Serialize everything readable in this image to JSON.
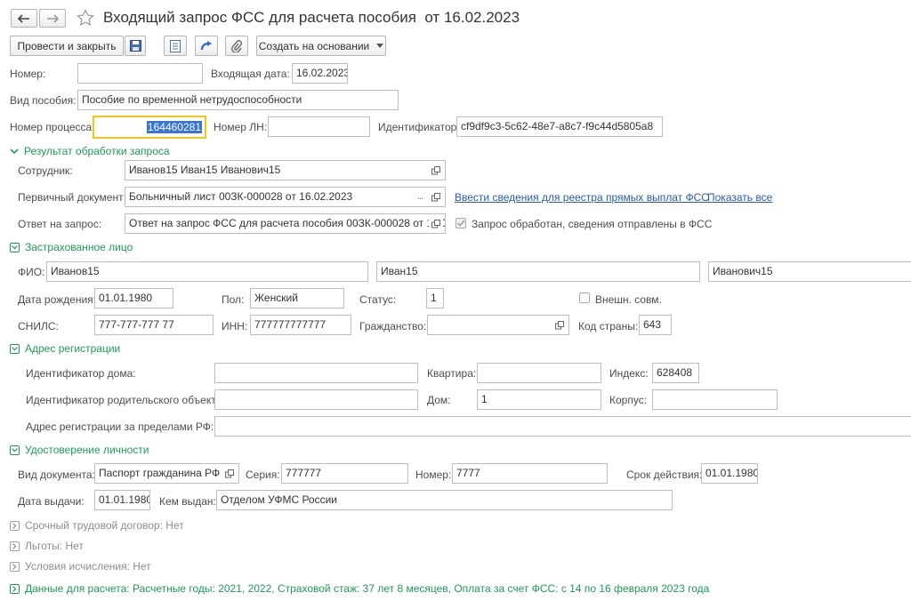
{
  "window": {
    "title": "Входящий запрос ФСС для расчета пособия  от 16.02.2023"
  },
  "toolbar": {
    "post_close": "Провести и закрыть",
    "create_based": "Создать на основании"
  },
  "header": {
    "number_label": "Номер:",
    "number_value": "",
    "in_date_label": "Входящая дата:",
    "in_date_value": "16.02.2023",
    "benefit_label": "Вид пособия:",
    "benefit_value": "Пособие по временной нетрудоспособности",
    "process_label": "Номер процесса:",
    "process_value": "164460281",
    "ln_label": "Номер ЛН:",
    "ln_value": "",
    "ident_label": "Идентификатор:",
    "ident_value": "cf9df9c3-5c62-48e7-a8c7-f9c44d5805a8"
  },
  "result": {
    "title": "Результат обработки запроса",
    "employee_label": "Сотрудник:",
    "employee_value": "Иванов15 Иван15 Иванович15",
    "primary_label": "Первичный документ:",
    "primary_value": "Больничный лист 00ЗК-000028 от 16.02.2023",
    "enter_link": "Ввести сведения для реестра прямых выплат ФСС",
    "show_all_link": "Показать все",
    "answer_label": "Ответ на запрос:",
    "answer_value": "Ответ на запрос ФСС для расчета пособия 00ЗК-000028 от 16.02.2023",
    "processed_label": "Запрос обработан, сведения отправлены в ФСС"
  },
  "insured": {
    "title": "Застрахованное лицо",
    "fio_label": "ФИО:",
    "last_name": "Иванов15",
    "first_name": "Иван15",
    "middle_name": "Иванович15",
    "birth_label": "Дата рождения:",
    "birth_value": "01.01.1980",
    "sex_label": "Пол:",
    "sex_value": "Женский",
    "status_label": "Статус:",
    "status_value": "1",
    "ext_label": "Внешн. совм.",
    "snils_label": "СНИЛС:",
    "snils_value": "777-777-777 77",
    "inn_label": "ИНН:",
    "inn_value": "777777777777",
    "citizen_label": "Гражданство:",
    "citizen_value": "",
    "country_label": "Код страны:",
    "country_value": "643"
  },
  "address": {
    "title": "Адрес регистрации",
    "house_id_label": "Идентификатор дома:",
    "house_id_value": "",
    "flat_label": "Квартира:",
    "flat_value": "",
    "index_label": "Индекс:",
    "index_value": "628408",
    "parent_id_label": "Идентификатор родительского объекта:",
    "parent_id_value": "",
    "house_label": "Дом:",
    "house_value": "1",
    "korpus_label": "Корпус:",
    "korpus_value": "",
    "abroad_label": "Адрес регистрации за пределами РФ:",
    "abroad_value": ""
  },
  "identity": {
    "title": "Удостоверение личности",
    "doc_type_label": "Вид документа:",
    "doc_type_value": "Паспорт гражданина РФ",
    "series_label": "Серия:",
    "series_value": "777777",
    "number_label": "Номер:",
    "number_value": "7777",
    "valid_label": "Срок действия:",
    "valid_value": "01.01.1980",
    "issue_date_label": "Дата выдачи:",
    "issue_date_value": "01.01.1980",
    "issued_by_label": "Кем выдан:",
    "issued_by_value": "Отделом УФМС России"
  },
  "collapsed": {
    "contract": "Срочный трудовой договор: Нет",
    "benefits": "Льготы: Нет",
    "conditions": "Условия исчисления: Нет",
    "calc_data": "Данные для расчета: Расчетные годы: 2021, 2022, Страховой стаж: 37 лет 8 месяцев, Оплата за счет ФСС: с 14 по 16 февраля 2023 года"
  },
  "colors": {
    "accent_green": "#1f9b55",
    "link_blue": "#2a5ab8",
    "focus_yellow": "#f5c518"
  }
}
